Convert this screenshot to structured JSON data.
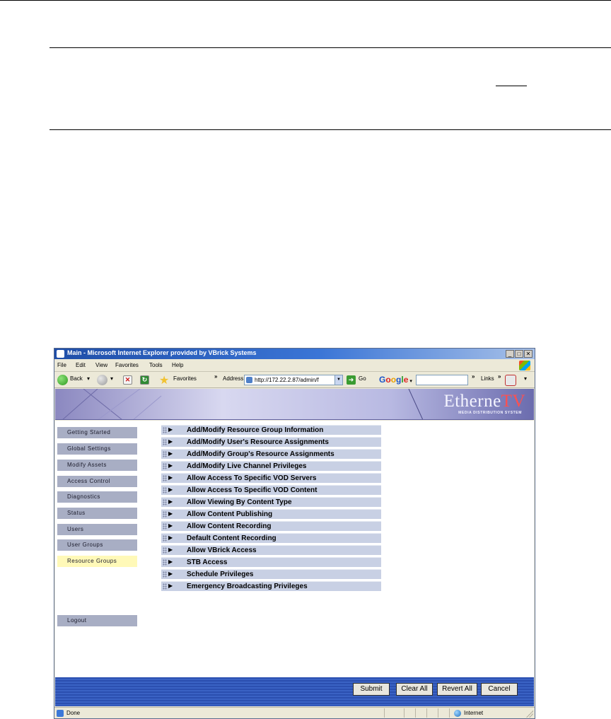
{
  "window": {
    "title": "Main - Microsoft Internet Explorer provided by VBrick Systems",
    "controls": [
      "_",
      "□",
      "✕"
    ]
  },
  "menu": [
    "File",
    "Edit",
    "View",
    "Favorites",
    "Tools",
    "Help"
  ],
  "toolbar": {
    "back_label": "Back",
    "favorites_label": "Favorites",
    "chevron": "»",
    "address_label": "Address",
    "address_value": "http://172.22.2.87/admin/f",
    "go_label": "Go",
    "google_label": "Google",
    "links_label": "Links"
  },
  "brand": {
    "name": "Etherne",
    "name_accent": "TV",
    "tagline": "MEDIA DISTRIBUTION SYSTEM"
  },
  "sidebar": {
    "items": [
      {
        "label": "Getting Started"
      },
      {
        "label": "Global Settings"
      },
      {
        "label": "Modify Assets"
      },
      {
        "label": "Access Control"
      },
      {
        "label": "Diagnostics"
      },
      {
        "label": "Status"
      },
      {
        "label": "Users"
      },
      {
        "label": "User Groups"
      },
      {
        "label": "Resource Groups",
        "active": true
      }
    ],
    "logout_label": "Logout"
  },
  "privileges": {
    "items": [
      "Add/Modify Resource Group Information",
      "Add/Modify User's Resource Assignments",
      "Add/Modify Group's Resource Assignments",
      "Add/Modify Live Channel Privileges",
      "Allow Access To Specific VOD Servers",
      "Allow Access To Specific VOD Content",
      "Allow Viewing By Content Type",
      "Allow Content Publishing",
      "Allow Content Recording",
      "Default Content Recording",
      "Allow VBrick Access",
      "STB Access",
      "Schedule Privileges",
      "Emergency Broadcasting Privileges"
    ]
  },
  "footer": {
    "submit_label": "Submit",
    "clear_label": "Clear All",
    "revert_label": "Revert All",
    "cancel_label": "Cancel"
  },
  "status": {
    "text": "Done",
    "zone": "Internet"
  }
}
